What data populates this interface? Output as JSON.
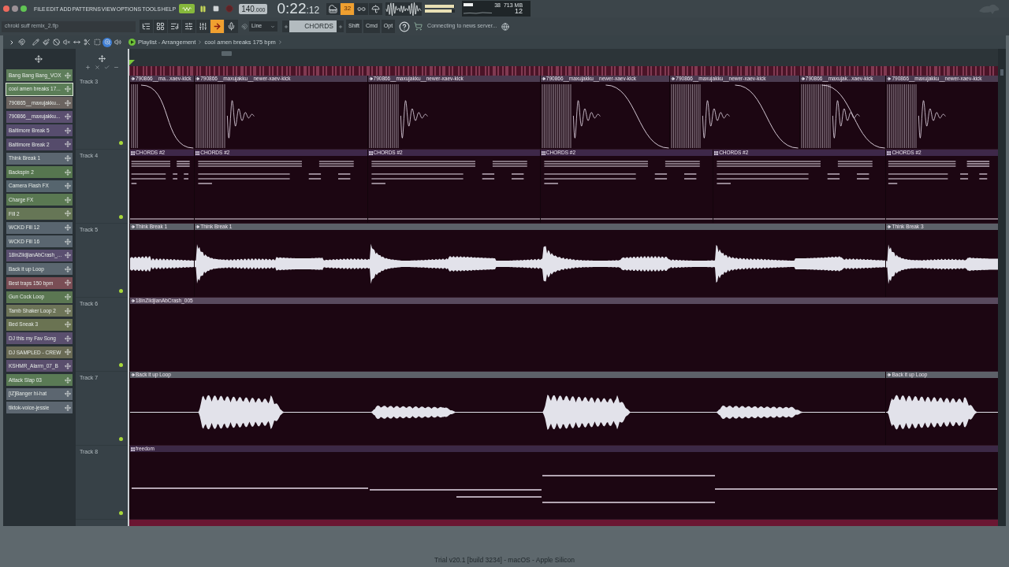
{
  "menu": [
    "FILE",
    "EDIT",
    "ADD",
    "PATTERNS",
    "VIEW",
    "OPTIONS",
    "TOOLS",
    "HELP"
  ],
  "transport": {
    "song_mode": true,
    "playing": true,
    "recording": false,
    "tempo": "140",
    "tempo_decimals": ".000",
    "time": "0:22",
    "time_fraction": ":12",
    "step_button": {
      "label": "32",
      "on": true
    }
  },
  "output_meters": [
    {
      "level": 0.97
    },
    {
      "level": 0.9
    }
  ],
  "performance": {
    "cpu": "38",
    "memory": "713 MB",
    "polyphony": "12"
  },
  "toolbar": {
    "file_name": "chrokl suff remix_2.flp",
    "arrow_toggle": {
      "on": true
    },
    "snap": "Line",
    "pattern": "CHORDS",
    "modifier_keys": [
      "Shift",
      "Cmd",
      "Opt"
    ],
    "news": "Connecting to news server..."
  },
  "playlist": {
    "tools": [
      {
        "selected": false
      },
      {
        "selected": false
      },
      {
        "selected": false
      },
      {
        "selected": false
      },
      {
        "selected": false
      },
      {
        "selected": false
      },
      {
        "selected": false
      },
      {
        "selected": true
      },
      {
        "selected": false
      }
    ],
    "title": "Playlist - Arrangement",
    "arrangement": "cool amen breaks 175 bpm"
  },
  "picker": [
    {
      "label": "Bang Bang Bang_VOX",
      "color": "#5e7d5a",
      "selected": false
    },
    {
      "label": "cool amen breaks 17...",
      "color": "#5b7d57",
      "selected": true
    },
    {
      "label": "790865__maxujakku...",
      "color": "#6b6460",
      "selected": false
    },
    {
      "label": "790866__maxujakku...",
      "color": "#5b4f70",
      "selected": false
    },
    {
      "label": "Baltimore Break 5",
      "color": "#574d6e",
      "selected": false
    },
    {
      "label": "Baltimore Break 2",
      "color": "#554b6b",
      "selected": false
    },
    {
      "label": "Think Break 1",
      "color": "#5b6670",
      "selected": false
    },
    {
      "label": "Backspin 2",
      "color": "#56764f",
      "selected": false
    },
    {
      "label": "Camera Flash FX",
      "color": "#56656e",
      "selected": false
    },
    {
      "label": "Charge FX",
      "color": "#5a7852",
      "selected": false
    },
    {
      "label": "Fill 2",
      "color": "#667656",
      "selected": false
    },
    {
      "label": "WCKD Fill 12",
      "color": "#59656f",
      "selected": false
    },
    {
      "label": "WCKD Fill 16",
      "color": "#5a6670",
      "selected": false
    },
    {
      "label": "18inZildjianAbCrash_...",
      "color": "#5a4f70",
      "selected": false
    },
    {
      "label": "Back it up Loop",
      "color": "#5a666f",
      "selected": false
    },
    {
      "label": "Best traps 150 bpm",
      "color": "#7a4e55",
      "selected": false
    },
    {
      "label": "Gun Cock Loop",
      "color": "#5b7752",
      "selected": false
    },
    {
      "label": "Tamb Shaker Loop 2",
      "color": "#6d7458",
      "selected": false
    },
    {
      "label": "Bed Sneak 3",
      "color": "#6a7352",
      "selected": false
    },
    {
      "label": "DJ this my Fav Song",
      "color": "#5a4f6e",
      "selected": false
    },
    {
      "label": "DJ SAMPLED - CREW",
      "color": "#6a6b55",
      "selected": false
    },
    {
      "label": "KSHMR_Alarm_07_B",
      "color": "#5a4e6d",
      "selected": false
    },
    {
      "label": "Attack Slap 03",
      "color": "#5a7a55",
      "selected": false
    },
    {
      "label": "[iZ]Banger hi-hat",
      "color": "#5c6670",
      "selected": false
    },
    {
      "label": "tiktok-voice-jessie",
      "color": "#5d6771",
      "selected": false
    }
  ],
  "tracks": [
    {
      "name": "Track 3",
      "enabled": true,
      "kind": "kick",
      "color": "#4b3b50",
      "clips": [
        {
          "label": "790866__ma...xaev-kick"
        },
        {
          "label": "790866__maxujakku__newer-xaev-kick"
        },
        {
          "label": "790866__maxujakku__newer-xaev-kick"
        },
        {
          "label": "790866__maxujakku__newer-xaev-kick"
        },
        {
          "label": "790866__maxujakku__newer-xaev-kick"
        },
        {
          "label": "790866__maxujak...xaev-kick"
        },
        {
          "label": "790866__maxujakku__newer-xaev-kick"
        }
      ]
    },
    {
      "name": "Track 4",
      "enabled": true,
      "kind": "chords",
      "color": "#3e2849",
      "clips": [
        {
          "label": "CHORDS #2"
        },
        {
          "label": "CHORDS #2"
        },
        {
          "label": "CHORDS #2"
        },
        {
          "label": "CHORDS #2"
        },
        {
          "label": "CHORDS #2"
        },
        {
          "label": "CHORDS #2"
        }
      ]
    },
    {
      "name": "Track 5",
      "enabled": true,
      "kind": "break",
      "color": "#5c6068",
      "clips": [
        {
          "label": "Think Break 1"
        },
        {
          "label": "Think Break 1"
        },
        {
          "label": "Think Break 3"
        }
      ]
    },
    {
      "name": "Track 6",
      "enabled": true,
      "kind": "crash",
      "color": "#594a5e",
      "clips": [
        {
          "label": "18inZildjianAbCrash_005"
        }
      ]
    },
    {
      "name": "Track 7",
      "enabled": true,
      "kind": "loop",
      "color": "#5d6169",
      "clips": [
        {
          "label": "Back it up Loop"
        },
        {
          "label": "Back it up Loop"
        }
      ]
    },
    {
      "name": "Track 8",
      "enabled": true,
      "kind": "melody",
      "color": "#3c2946",
      "clips": [
        {
          "label": "freedom"
        }
      ]
    }
  ],
  "status_bar": "Trial v20.1 [build 3234] - macOS - Apple Silicon"
}
